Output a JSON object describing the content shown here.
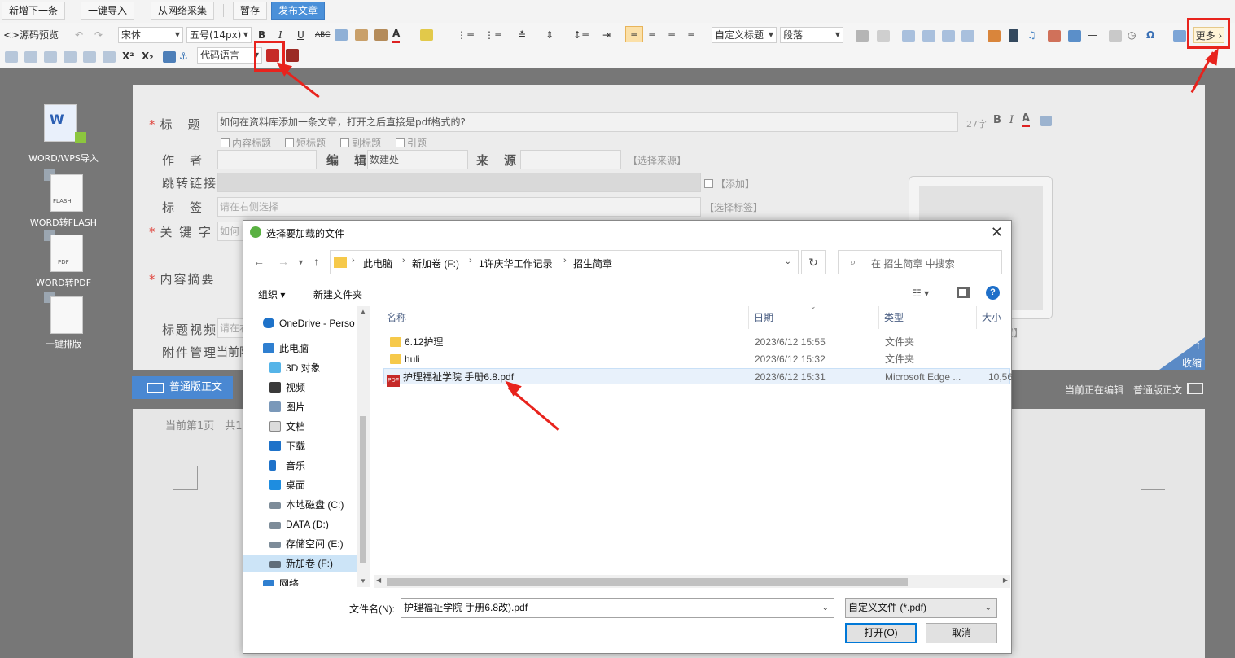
{
  "actionbar": {
    "buttons": [
      "新增下一条",
      "一键导入",
      "从网络采集",
      "暂存",
      "发布文章"
    ]
  },
  "toolbar": {
    "source": "<>源码",
    "preview": "预览",
    "font_family": "宋体",
    "font_size": "五号(14px)",
    "bold": "B",
    "italic": "I",
    "underline": "U",
    "strike": "ABC",
    "heading_select": "自定义标题",
    "paragraph_select": "段落",
    "code_lang": "代码语言",
    "more": "更多",
    "superscript": "X²",
    "subscript": "X₂"
  },
  "left_tools": [
    {
      "label": "WORD/WPS导入",
      "badge": "W"
    },
    {
      "label": "WORD转FLASH",
      "badge": "FLASH"
    },
    {
      "label": "WORD转PDF",
      "badge": "PDF"
    },
    {
      "label": "一键排版",
      "badge": ""
    }
  ],
  "form": {
    "title_label": "标　题",
    "title_value": "如何在资料库添加一条文章，打开之后直接是pdf格式的?",
    "char_count": "27字",
    "title_opts": [
      "内容标题",
      "短标题",
      "副标题",
      "引题"
    ],
    "author_label": "作　者",
    "editor_label": "编　辑",
    "editor_value": "数建处",
    "source_label": "来　源",
    "choose_source": "【选择来源】",
    "jump_label": "跳转链接",
    "add_label": "【添加】",
    "tags_label": "标　签",
    "tags_placeholder": "请在右侧选择",
    "choose_tags": "【选择标签】",
    "keyword_label": "关 键 字",
    "keyword_value": "如何",
    "summary_label": "内容摘要",
    "video_label": "标题视频",
    "video_placeholder": "请在右",
    "attach_label": "附件管理",
    "attach_value": "当前附",
    "img_bracket": "置】",
    "collapse": "收缩"
  },
  "editor": {
    "mode_tab": "普通版正文",
    "status_right": "当前正在编辑",
    "mode_right": "普通版正文",
    "page_info": "当前第1页　共1"
  },
  "dialog": {
    "title": "选择要加载的文件",
    "breadcrumb": [
      "此电脑",
      "新加卷 (F:)",
      "1许庆华工作记录",
      "招生简章"
    ],
    "search_placeholder": "在 招生简章 中搜索",
    "organize": "组织 ▾",
    "new_folder": "新建文件夹",
    "nav_items": [
      {
        "label": "OneDrive - Perso",
        "icon": "cloud-icon"
      },
      {
        "label": "此电脑",
        "icon": "computer-icon"
      },
      {
        "label": "3D 对象",
        "icon": "cube-icon"
      },
      {
        "label": "视频",
        "icon": "video-icon"
      },
      {
        "label": "图片",
        "icon": "picture-icon"
      },
      {
        "label": "文档",
        "icon": "document-icon"
      },
      {
        "label": "下载",
        "icon": "download-icon"
      },
      {
        "label": "音乐",
        "icon": "music-icon"
      },
      {
        "label": "桌面",
        "icon": "desktop-icon"
      },
      {
        "label": "本地磁盘 (C:)",
        "icon": "drive-icon"
      },
      {
        "label": "DATA (D:)",
        "icon": "drive-icon"
      },
      {
        "label": "存储空间 (E:)",
        "icon": "drive-icon"
      },
      {
        "label": "新加卷 (F:)",
        "icon": "drive-icon"
      },
      {
        "label": "网络",
        "icon": "network-icon"
      }
    ],
    "columns": [
      "名称",
      "日期",
      "类型",
      "大小"
    ],
    "files": [
      {
        "name": "6.12护理",
        "date": "2023/6/12 15:55",
        "type": "文件夹",
        "size": "",
        "kind": "folder"
      },
      {
        "name": "huli",
        "date": "2023/6/12 15:32",
        "type": "文件夹",
        "size": "",
        "kind": "folder"
      },
      {
        "name": "护理福祉学院 手册6.8.pdf",
        "date": "2023/6/12 15:31",
        "type": "Microsoft Edge ...",
        "size": "10,56",
        "kind": "pdf"
      }
    ],
    "filename_label": "文件名(N):",
    "filename_value": "护理福祉学院 手册6.8改).pdf",
    "filetype_value": "自定义文件 (*.pdf)",
    "open_button": "打开(O)",
    "cancel_button": "取消"
  }
}
